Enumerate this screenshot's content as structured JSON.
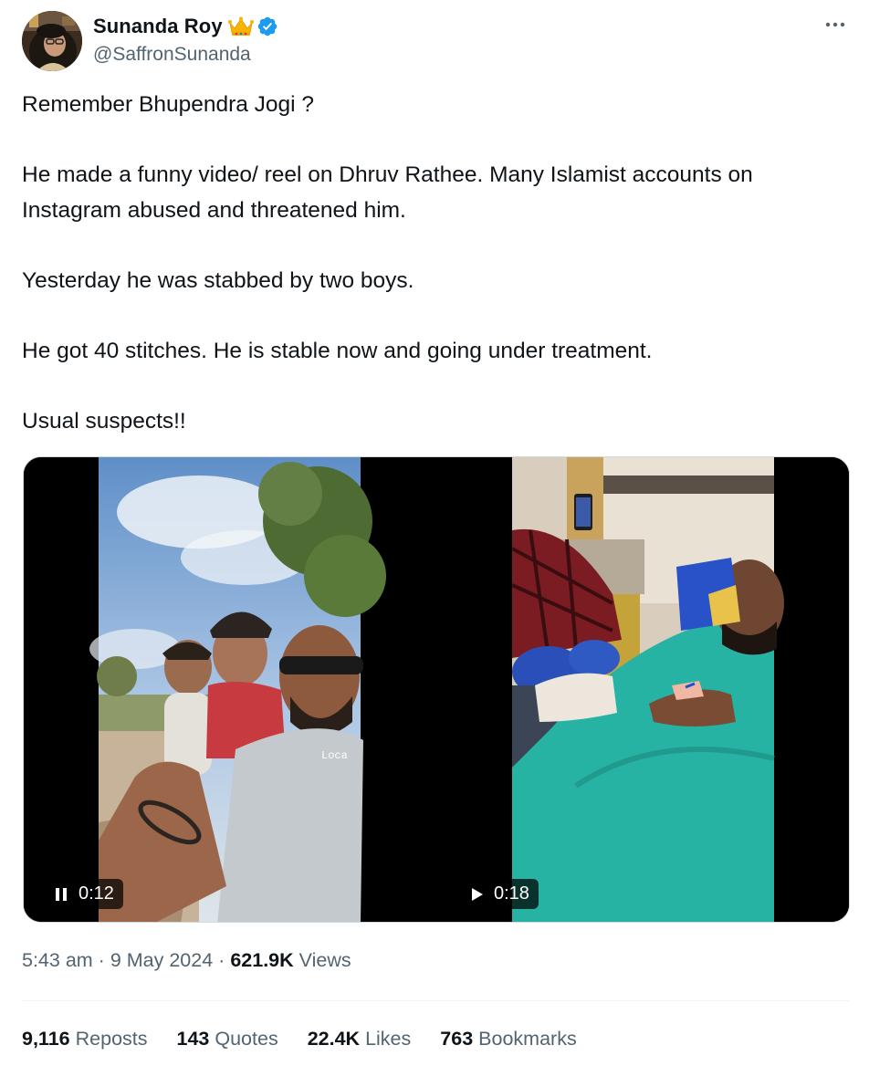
{
  "author": {
    "display_name": "Sunanda Roy",
    "handle": "@SaffronSunanda",
    "badges": [
      "crown-emoji",
      "verified-badge"
    ]
  },
  "tweet": {
    "paragraphs": [
      "Remember Bhupendra Jogi ?",
      "He made a funny video/ reel on Dhruv Rathee. Many Islamist accounts on Instagram abused and threatened him.",
      "Yesterday he was stabbed by two boys.",
      "He got 40 stitches. He is stable now and going under treatment.",
      "Usual suspects!!"
    ]
  },
  "media": {
    "videos": [
      {
        "state_icon": "pause-icon",
        "duration": "0:12",
        "overlay_text": "Loca"
      },
      {
        "state_icon": "play-icon",
        "duration": "0:18"
      }
    ]
  },
  "meta": {
    "time": "5:43 am",
    "separator": "·",
    "date": "9 May 2024",
    "views_count": "621.9K",
    "views_label": "Views"
  },
  "stats": [
    {
      "count": "9,116",
      "label": "Reposts"
    },
    {
      "count": "143",
      "label": "Quotes"
    },
    {
      "count": "22.4K",
      "label": "Likes"
    },
    {
      "count": "763",
      "label": "Bookmarks"
    }
  ],
  "colors": {
    "text_primary": "#0f1419",
    "text_secondary": "#536471",
    "verified_blue": "#1d9bf0",
    "divider": "#eff3f4"
  }
}
